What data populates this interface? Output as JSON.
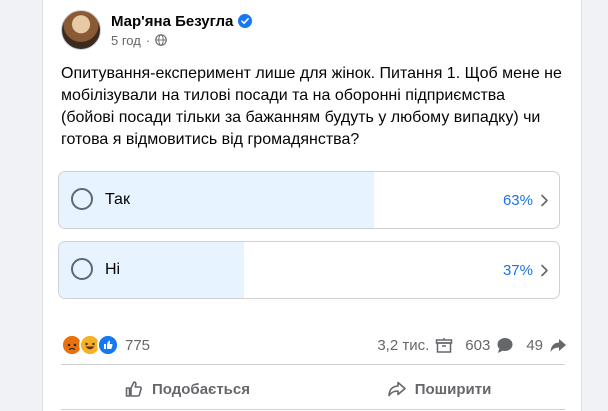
{
  "post": {
    "author": "Мар'яна Безугла",
    "time": "5 год",
    "text_lines": [
      "Опитування-експеримент лише для жінок. Питання 1. Щоб мене не",
      "мобілізували на тилові посади та на оборонні підприємства",
      "(бойові посади тільки за бажанням будуть у любому випадку) чи",
      "готова я відмовитись від громадянства?"
    ]
  },
  "poll": {
    "options": [
      {
        "label": "Так",
        "percent_text": "63%",
        "percent": 63
      },
      {
        "label": "Ні",
        "percent_text": "37%",
        "percent": 37
      }
    ]
  },
  "stats": {
    "reactions_count": "775",
    "views": "3,2 тис.",
    "comments": "603",
    "shares": "49"
  },
  "actions": {
    "like": "Подобається",
    "share": "Поширити"
  },
  "colors": {
    "accent": "#1b74e4",
    "poll_fill": "#e7f3ff",
    "angry": "#e9710f",
    "haha": "#f7b125",
    "like": "#1877f2"
  },
  "icons": [
    "verified-badge-icon",
    "globe-icon",
    "radio-icon",
    "chevron-right-icon",
    "angry-reaction-icon",
    "haha-reaction-icon",
    "like-reaction-icon",
    "views-icon",
    "comment-icon",
    "share-arrow-icon",
    "thumbs-up-icon",
    "share-icon"
  ]
}
